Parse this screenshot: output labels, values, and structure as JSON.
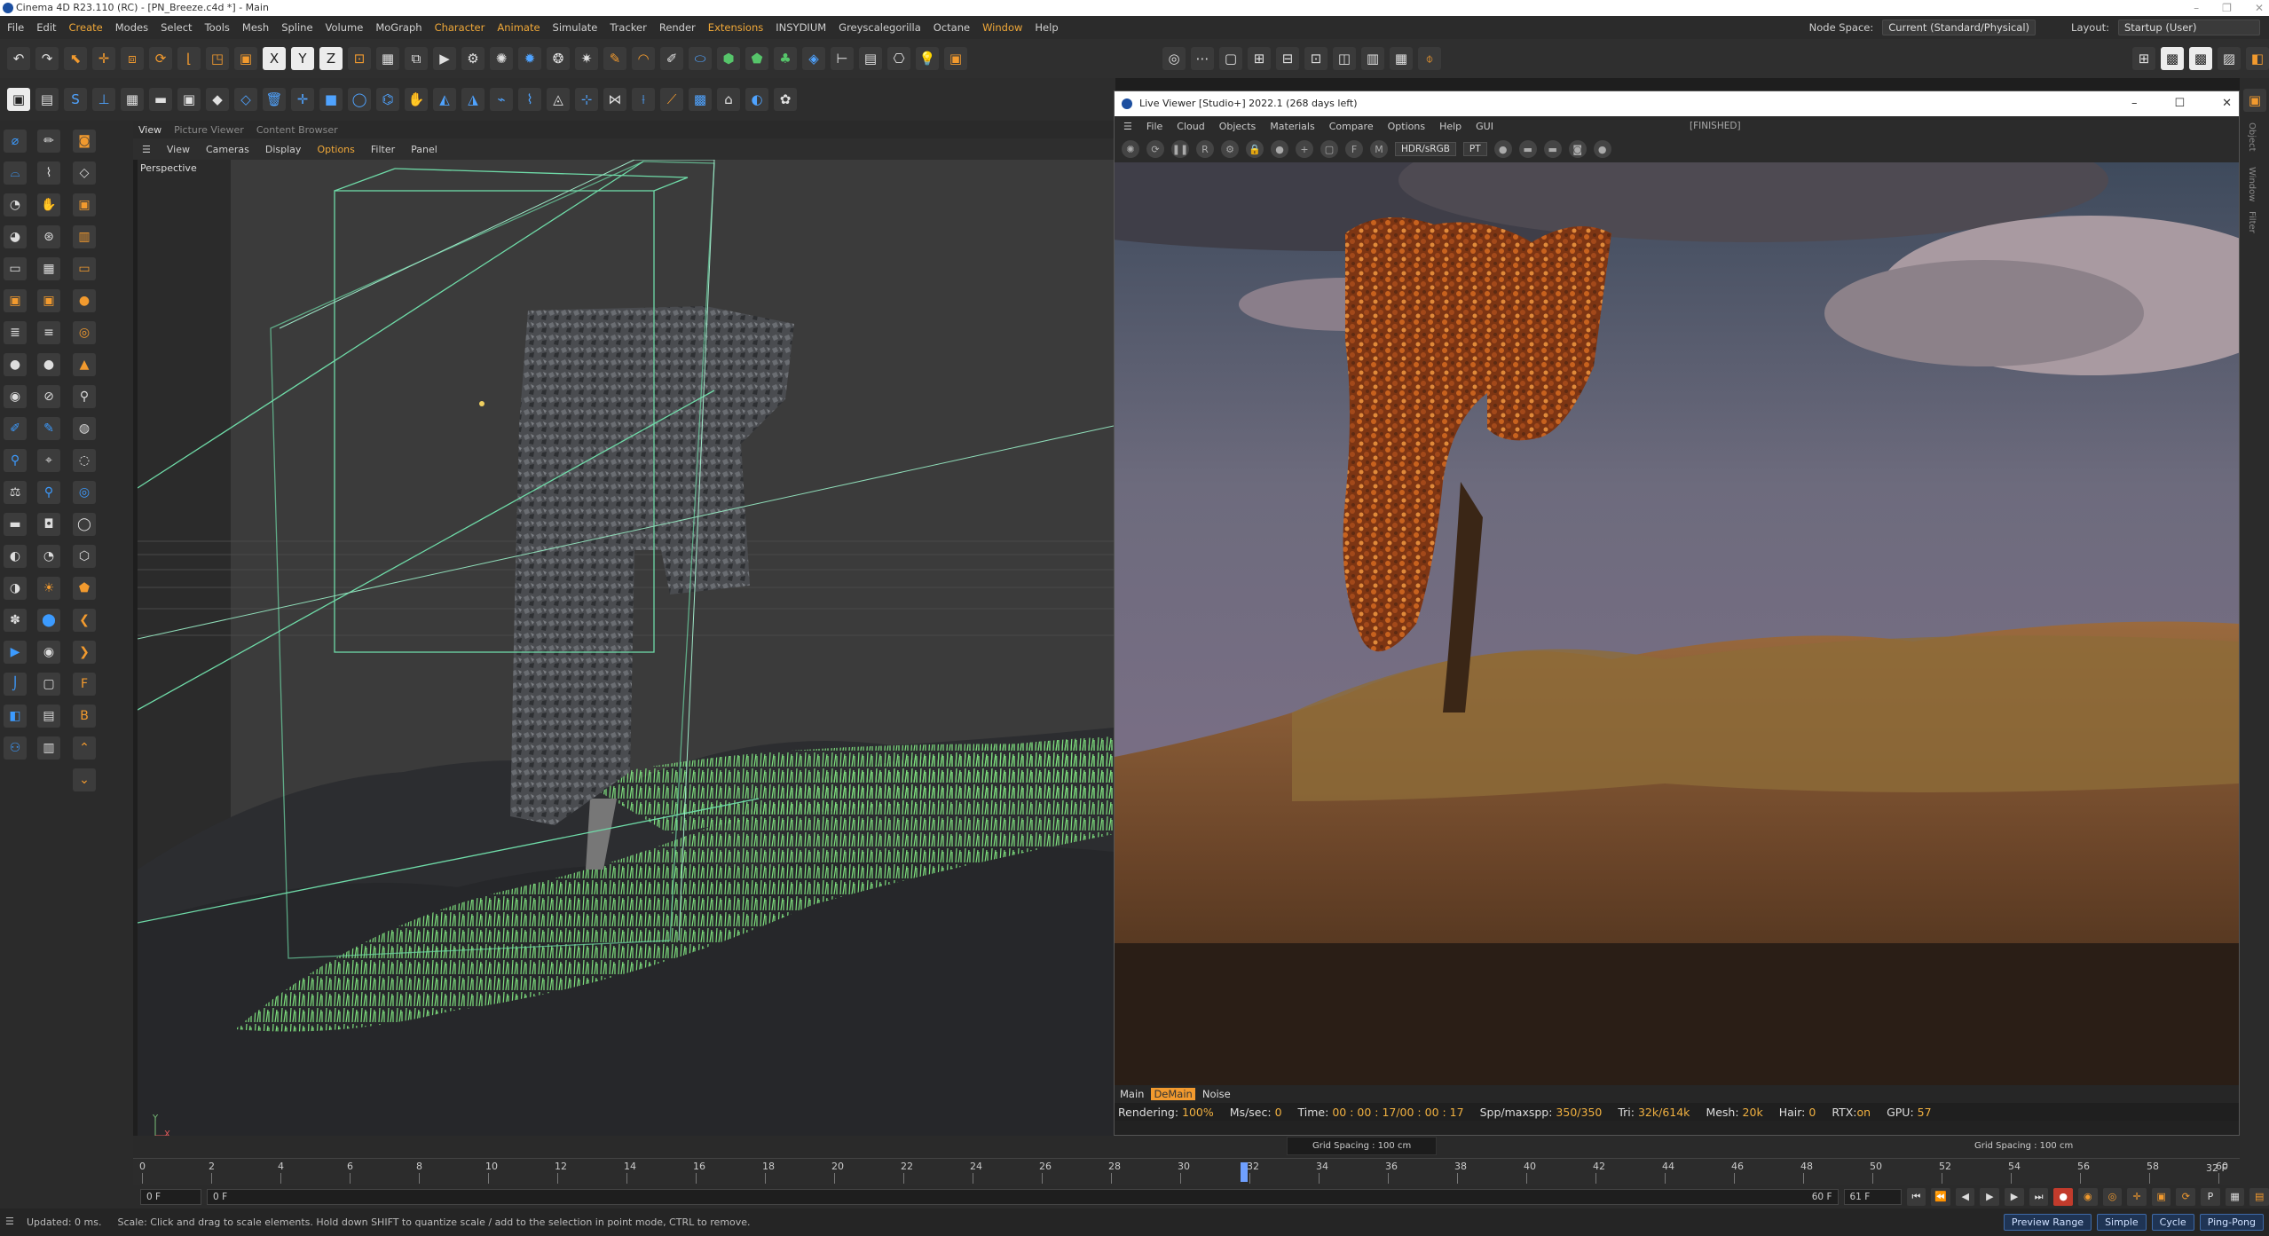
{
  "window": {
    "title": "Cinema 4D R23.110 (RC) - [PN_Breeze.c4d *] - Main"
  },
  "menubar": {
    "items": [
      "File",
      "Edit",
      "Create",
      "Modes",
      "Select",
      "Tools",
      "Mesh",
      "Spline",
      "Volume",
      "MoGraph",
      "Character",
      "Animate",
      "Simulate",
      "Tracker",
      "Render",
      "Extensions",
      "INSYDIUM",
      "Greyscalegorilla",
      "Octane",
      "Window",
      "Help"
    ],
    "node_space_label": "Node Space:",
    "node_space_value": "Current (Standard/Physical)",
    "layout_label": "Layout:",
    "layout_value": "Startup (User)"
  },
  "viewport": {
    "tabs": [
      "View",
      "Picture Viewer",
      "Content Browser"
    ],
    "menu": [
      "View",
      "Cameras",
      "Display",
      "Options",
      "Filter",
      "Panel"
    ],
    "label": "Perspective",
    "axis_x": "X",
    "axis_y": "Y"
  },
  "live_viewer": {
    "title": "Live Viewer [Studio+] 2022.1 (268 days left)",
    "menu": [
      "File",
      "Cloud",
      "Objects",
      "Materials",
      "Compare",
      "Options",
      "Help",
      "GUI"
    ],
    "status": "[FINISHED]",
    "colorspace": "HDR/sRGB",
    "kernel": "PT",
    "tabs": [
      "Main",
      "DeMain",
      "Noise"
    ],
    "info": {
      "rendering_label": "Rendering:",
      "rendering": "100%",
      "mssec_label": "Ms/sec:",
      "mssec": "0",
      "time_label": "Time:",
      "time": "00 : 00 : 17/00 : 00 : 17",
      "spp_label": "Spp/maxspp:",
      "spp": "350/350",
      "tri_label": "Tri:",
      "tri": "32k/614k",
      "mesh_label": "Mesh:",
      "mesh": "20k",
      "hair_label": "Hair:",
      "hair": "0",
      "rtx_label": "RTX:",
      "rtx": "on",
      "gpu_label": "GPU:",
      "gpu": "57"
    }
  },
  "side_panel": {
    "tabs": [
      "Object",
      "Window",
      "Filter"
    ]
  },
  "grid_spacing_left": "Grid Spacing : 100 cm",
  "grid_spacing_right": "Grid Spacing : 100 cm",
  "timeline": {
    "ticks": [
      "0",
      "2",
      "4",
      "6",
      "8",
      "10",
      "12",
      "14",
      "16",
      "18",
      "20",
      "22",
      "24",
      "26",
      "28",
      "30",
      "32",
      "34",
      "36",
      "38",
      "40",
      "42",
      "44",
      "46",
      "48",
      "50",
      "52",
      "54",
      "56",
      "58",
      "60"
    ],
    "end_label": "32 F"
  },
  "transport": {
    "start": "0 F",
    "current": "0 F",
    "end": "60 F",
    "max": "61 F"
  },
  "statusbar": {
    "updated": "Updated: 0 ms.",
    "hint": "Scale: Click and drag to scale elements. Hold down SHIFT to quantize scale / add to the selection in point mode, CTRL to remove.",
    "preview_range": "Preview Range",
    "simple": "Simple",
    "cycle": "Cycle",
    "pingpong": "Ping-Pong"
  }
}
